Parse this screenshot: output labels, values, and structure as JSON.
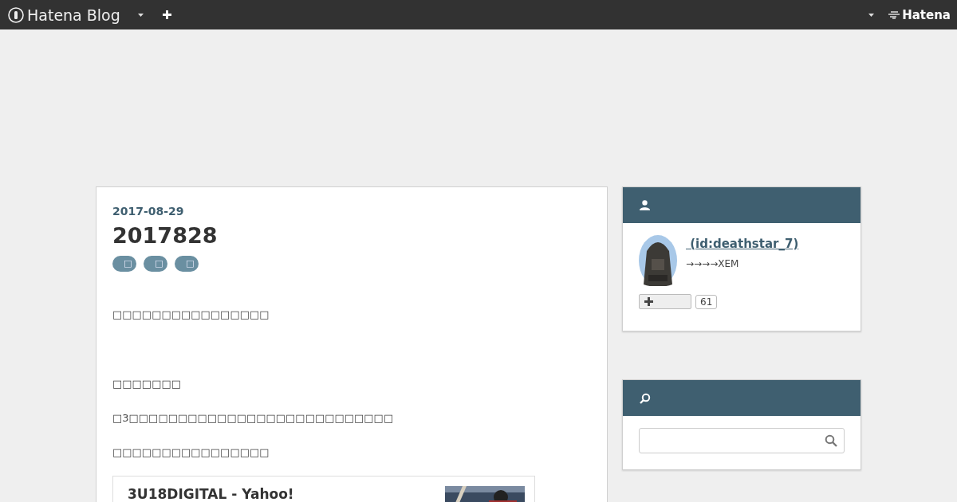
{
  "header": {
    "logo": "Hatena Blog",
    "right_logo": "Hatena"
  },
  "entry": {
    "date": "2017-08-29",
    "title": "2017828",
    "tags": [
      "□",
      "□",
      "□"
    ],
    "paragraphs": [
      "□□□□□□□□□□□□□□□□",
      "□□□□□□□",
      "□3□□□□□□□□□□□□□□□□□□□□□□□□□□□",
      "□□□□□□□□□□□□□□□□"
    ],
    "link_card": {
      "title": "3U18DIGITAL - Yahoo!"
    }
  },
  "profile": {
    "name": " (id:deathstar_7)",
    "description": "→→→→XEM",
    "follow_count": "61"
  }
}
